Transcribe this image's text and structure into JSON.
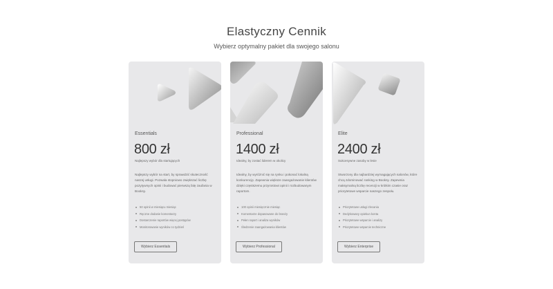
{
  "header": {
    "title": "Elastyczny Cennik",
    "subtitle": "Wybierz optymalny pakiet dla swojego salonu"
  },
  "plans": [
    {
      "name": "Essentials",
      "price": "800 zł",
      "tagline": "Najlepszy wybór dla startujących",
      "description": "Najlepszy wybór na start, by sprawdzić skuteczność naszej usługi. Pozwala stopniowo zwiększać liczbę pozytywnych opinii i budować pierwszą falę zaufania w Booksy.",
      "features": [
        "50 opinii w miesiącu miesiąc",
        "Ręczne dodanie komentarzy",
        "Dostarczenie raportów więcej postępów",
        "Monitorowanie wyników co tydzień"
      ],
      "cta": "Wybierz Essentials"
    },
    {
      "name": "Professional",
      "price": "1400 zł",
      "tagline": "Idealny, by zostać liderem w okolicy",
      "description": "Idealny, by wyróżnić się na rynku i pokonać lokalną konkurencję. Zapewnia większe zaangażowanie klientów dzięki częstszemu przyrostowi opinii i rozbudowanym raportom.",
      "features": [
        "100 opinii miesięcznie miesiąc",
        "Komentarze dopasowane do branży",
        "Pełen raport i analiza wyników",
        "Śledzenie zaangażowania klientów"
      ],
      "cta": "Wybierz Professional"
    },
    {
      "name": "Elite",
      "price": "2400 zł",
      "tagline": "Sukcesywne zasoby w lesie",
      "description": "Stworzony dla najbardziej wymagających salonów, które chcą zdominować ranking w Booksy. Zapewnia maksymalną liczbę recenzji w krótkim czasie oraz priorytetowe wsparcie naszego zespołu.",
      "features": [
        "Priorytetowe usługi zlecania",
        "Dedykowany opiekun konta",
        "Priorytetowe wsparcie i analizy",
        "Priorytetowe wsparcie techniczne"
      ],
      "cta": "Wybierz Enterprise"
    }
  ]
}
